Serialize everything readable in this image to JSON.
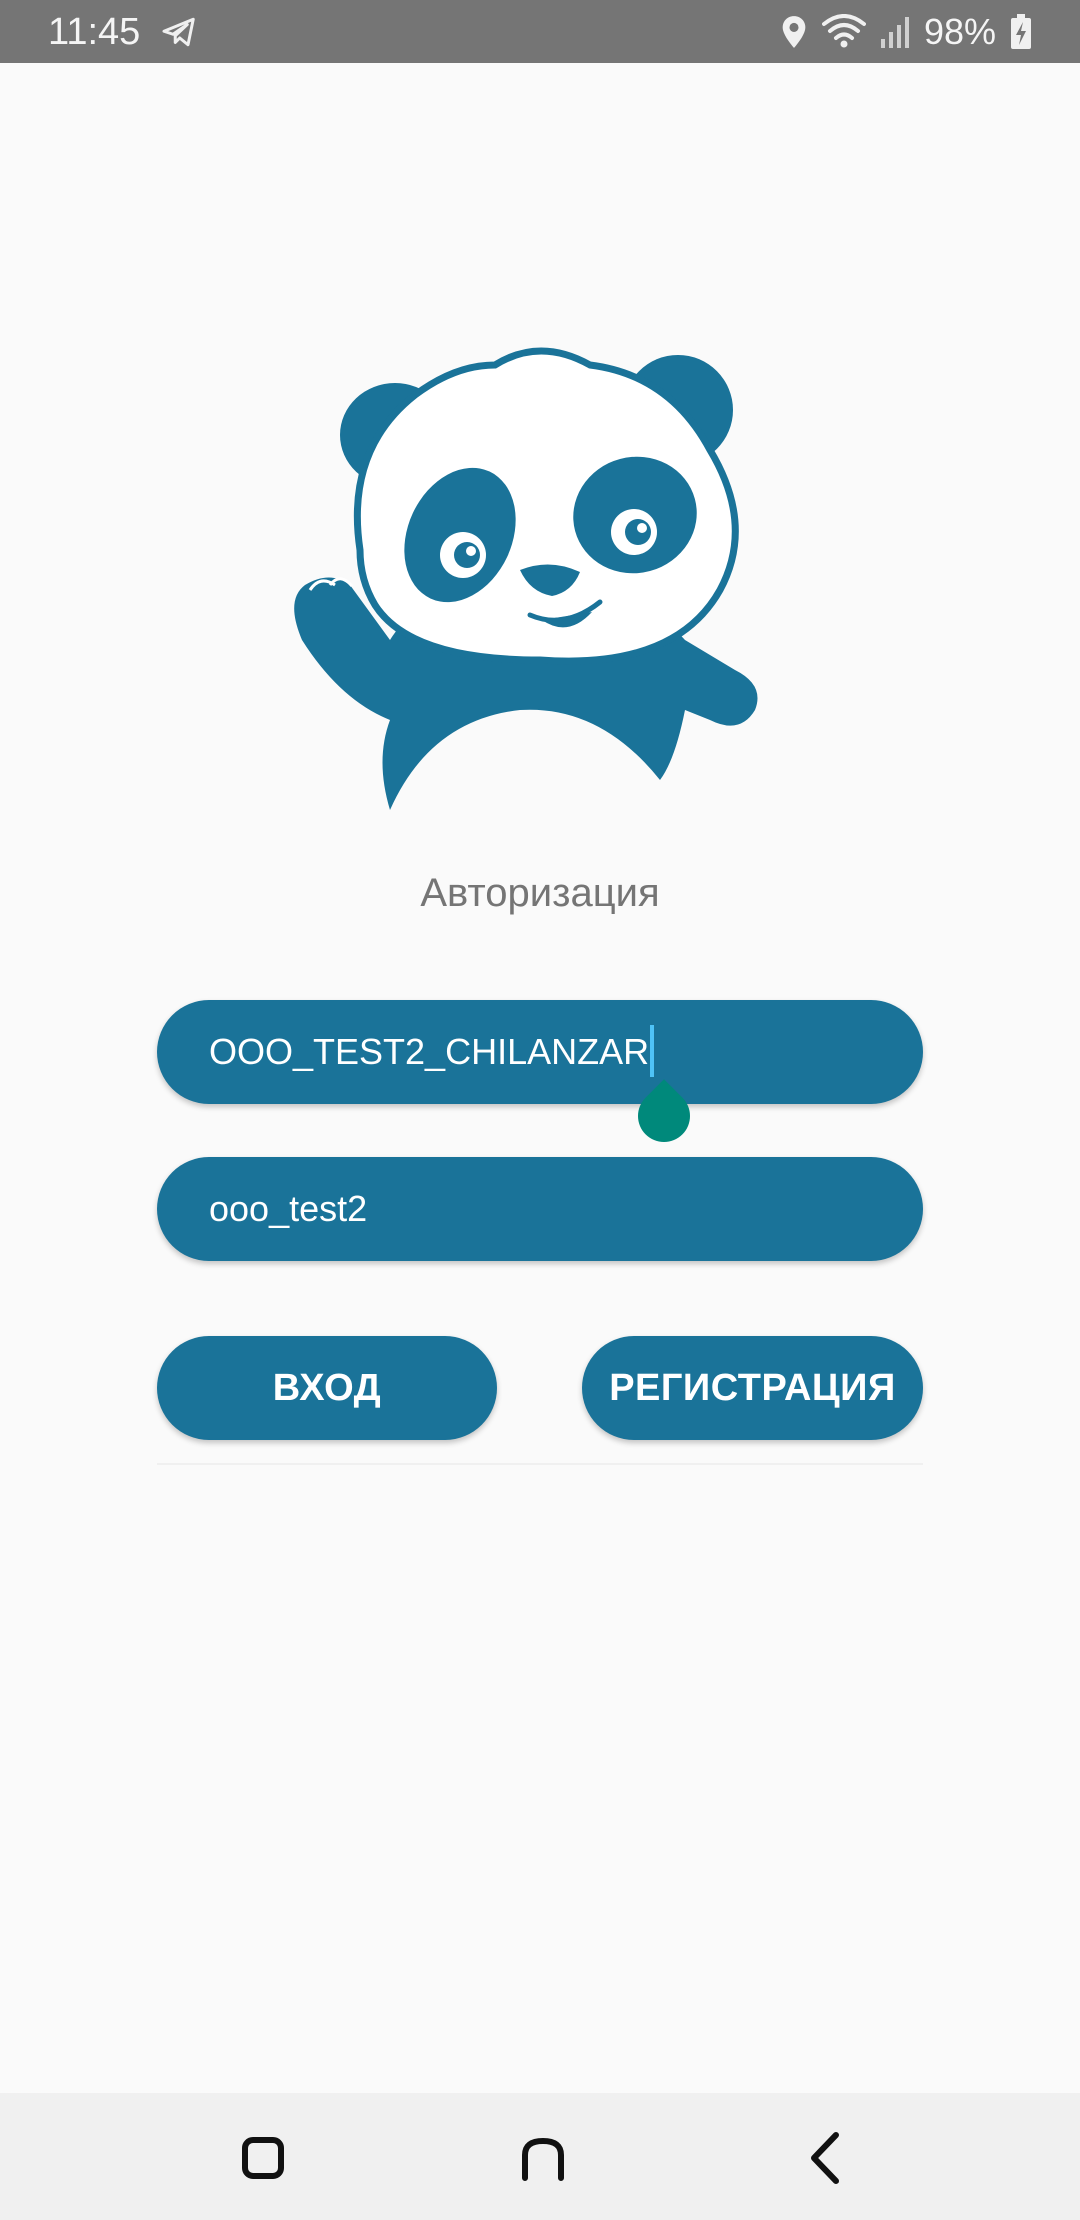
{
  "status_bar": {
    "time": "11:45",
    "battery_percent": "98%",
    "icons": [
      "telegram-icon",
      "location-icon",
      "wifi-icon",
      "signal-icon",
      "battery-charging-icon"
    ]
  },
  "logo": {
    "icon": "panda-logo",
    "color": "#1a7399"
  },
  "title": "Авторизация",
  "form": {
    "login_value": "OOO_TEST2_CHILANZAR",
    "password_value": "ooo_test2"
  },
  "buttons": {
    "login_label": "ВХОД",
    "register_label": "РЕГИСТРАЦИЯ"
  },
  "nav_bar": {
    "icons": [
      "recents-icon",
      "home-icon",
      "back-icon"
    ]
  },
  "colors": {
    "accent": "#1a7399",
    "status_bar": "#757575",
    "cursor_handle": "#00897b",
    "background": "#fafafa"
  }
}
